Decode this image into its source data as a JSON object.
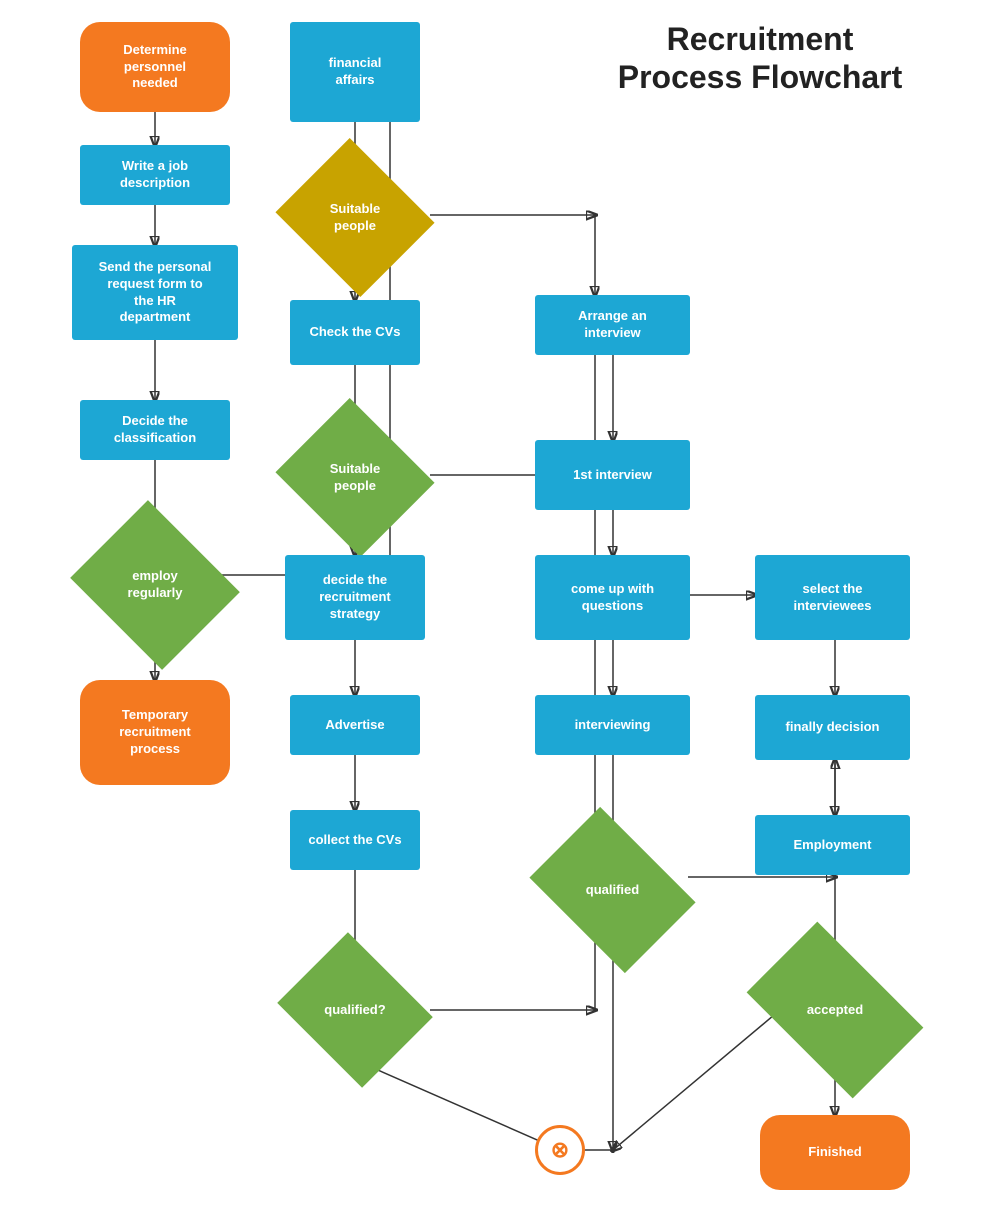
{
  "title": "Recruitment\nProcess Flowchart",
  "nodes": {
    "determine": "Determine\npersonnel\nneeded",
    "write_job": "Write a job\ndescription",
    "send_request": "Send the personal\nrequest form to\nthe HR\ndepartment",
    "decide_class": "Decide the\nclassification",
    "employ_regularly": "employ\nregularly",
    "temp_recruitment": "Temporary\nrecruitment\nprocess",
    "financial": "financial\naffairs",
    "suitable1": "Suitable\npeople",
    "check_cvs": "Check the CVs",
    "suitable2": "Suitable\npeople",
    "decide_strategy": "decide the\nrecruitment\nstrategy",
    "advertise": "Advertise",
    "collect_cvs": "collect the CVs",
    "qualified_q": "qualified?",
    "arrange_interview": "Arrange an\ninterview",
    "first_interview": "1st interview",
    "come_up": "come up with\nquestions",
    "interviewing": "interviewing",
    "qualified": "qualified",
    "select_interviewees": "select the\ninterviewees",
    "finally_decision": "finally decision",
    "employment": "Employment",
    "accepted": "accepted",
    "finished": "Finished",
    "reject": "⊗"
  }
}
